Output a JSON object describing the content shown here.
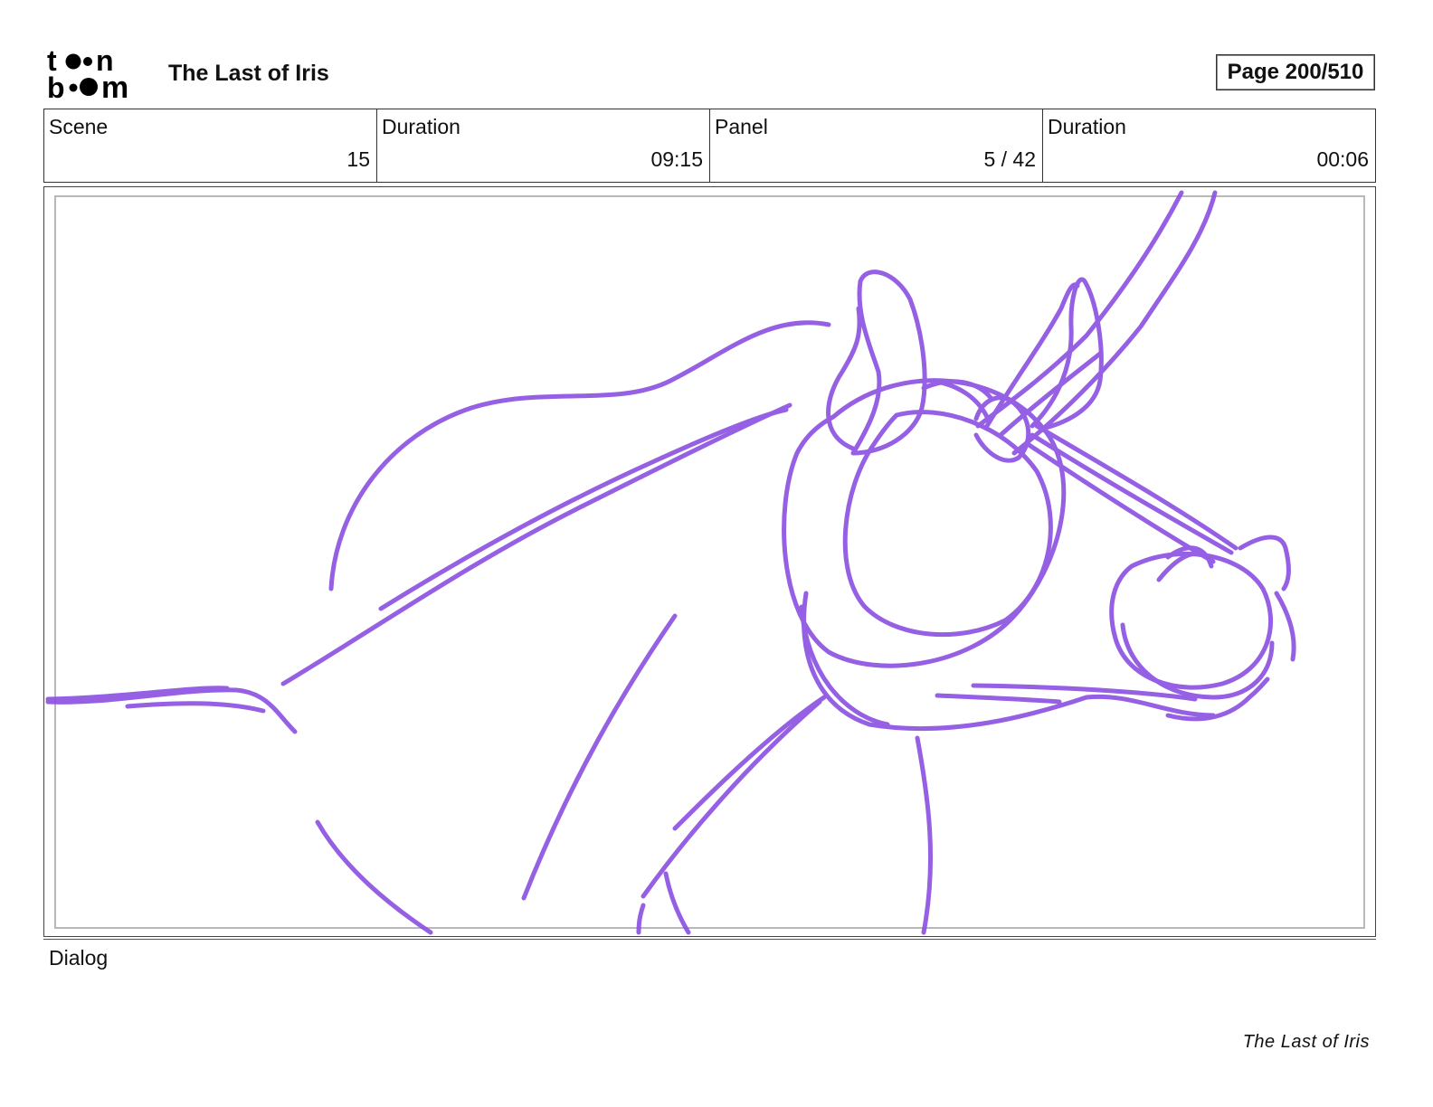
{
  "header": {
    "logo_text": "toon boom",
    "project_title": "The Last of Iris",
    "page_indicator": "Page 200/510"
  },
  "info": {
    "scene_label": "Scene",
    "scene_value": "15",
    "scene_duration_label": "Duration",
    "scene_duration_value": "09:15",
    "panel_label": "Panel",
    "panel_value": "5 / 42",
    "panel_duration_label": "Duration",
    "panel_duration_value": "00:06"
  },
  "panel": {
    "sketch_color": "#8a4fe0"
  },
  "dialog": {
    "label": "Dialog"
  },
  "footer": {
    "title": "The Last of Iris"
  }
}
